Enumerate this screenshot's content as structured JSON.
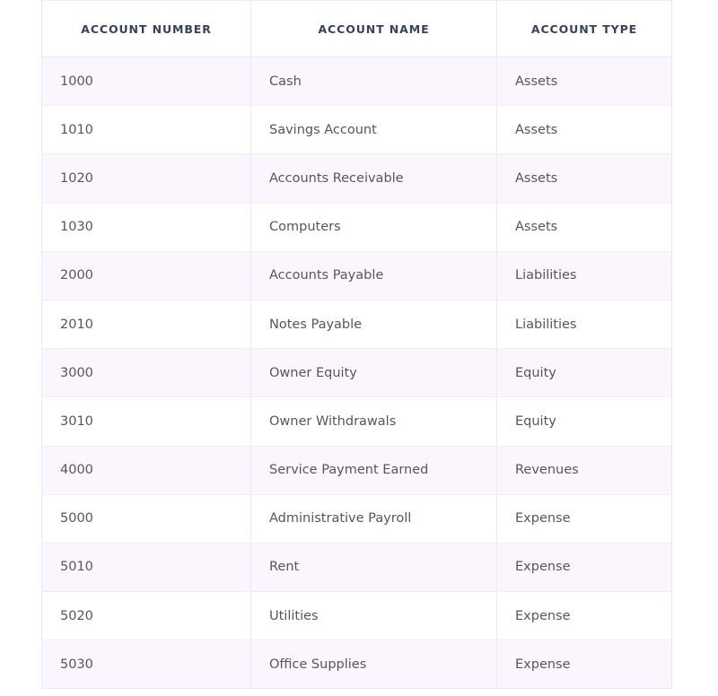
{
  "table": {
    "name": "chart-of-accounts",
    "columns": [
      {
        "key": "account_number",
        "label": "ACCOUNT NUMBER",
        "align": "center"
      },
      {
        "key": "account_name",
        "label": "ACCOUNT NAME",
        "align": "center"
      },
      {
        "key": "account_type",
        "label": "ACCOUNT TYPE",
        "align": "center"
      }
    ],
    "rows": [
      {
        "account_number": "1000",
        "account_name": "Cash",
        "account_type": "Assets"
      },
      {
        "account_number": "1010",
        "account_name": "Savings Account",
        "account_type": "Assets"
      },
      {
        "account_number": "1020",
        "account_name": "Accounts Receivable",
        "account_type": "Assets"
      },
      {
        "account_number": "1030",
        "account_name": "Computers",
        "account_type": "Assets"
      },
      {
        "account_number": "2000",
        "account_name": "Accounts Payable",
        "account_type": "Liabilities"
      },
      {
        "account_number": "2010",
        "account_name": "Notes Payable",
        "account_type": "Liabilities"
      },
      {
        "account_number": "3000",
        "account_name": "Owner Equity",
        "account_type": "Equity"
      },
      {
        "account_number": "3010",
        "account_name": "Owner Withdrawals",
        "account_type": "Equity"
      },
      {
        "account_number": "4000",
        "account_name": "Service Payment Earned",
        "account_type": "Revenues"
      },
      {
        "account_number": "5000",
        "account_name": "Administrative Payroll",
        "account_type": "Expense"
      },
      {
        "account_number": "5010",
        "account_name": "Rent",
        "account_type": "Expense"
      },
      {
        "account_number": "5020",
        "account_name": "Utilities",
        "account_type": "Expense"
      },
      {
        "account_number": "5030",
        "account_name": "Office Supplies",
        "account_type": "Expense"
      }
    ],
    "row_count": 13
  },
  "colors": {
    "page_background": "#ffffff",
    "header_text": "#39415a",
    "body_text": "#565659",
    "row_stripe": "#fbf6fd",
    "row_base": "#ffffff",
    "border": "#ece7f0",
    "row_divider": "#f3eef6"
  }
}
